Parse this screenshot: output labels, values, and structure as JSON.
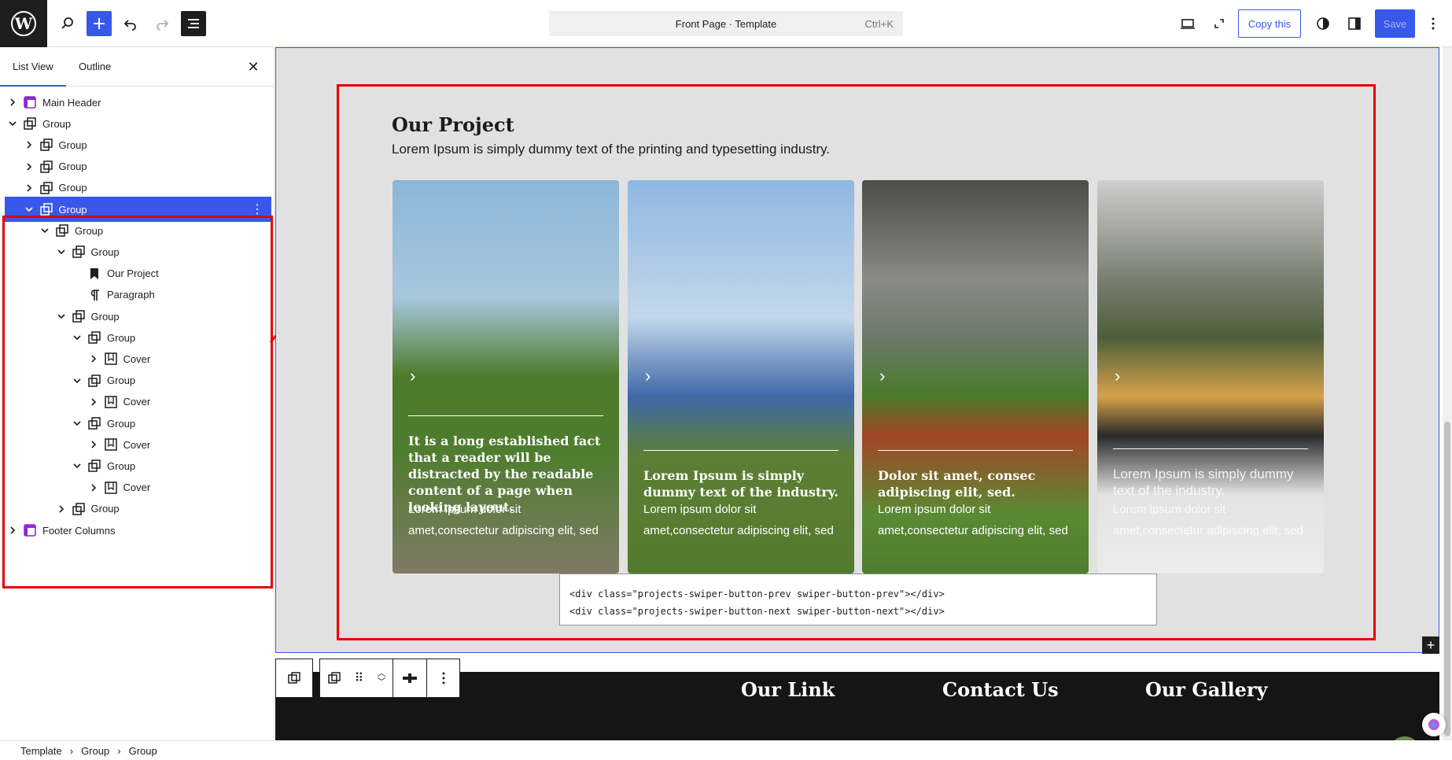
{
  "topbar": {
    "command_label": "Front Page · Template",
    "command_shortcut": "Ctrl+K",
    "copy_label": "Copy this",
    "save_label": "Save"
  },
  "sidebar": {
    "tabs": [
      "List View",
      "Outline"
    ],
    "items": [
      {
        "label": "Main Header"
      },
      {
        "label": "Group"
      },
      {
        "label": "Group"
      },
      {
        "label": "Group"
      },
      {
        "label": "Group"
      },
      {
        "label": "Group"
      },
      {
        "label": "Group"
      },
      {
        "label": "Group"
      },
      {
        "label": "Our Project"
      },
      {
        "label": "Paragraph"
      },
      {
        "label": "Group"
      },
      {
        "label": "Group"
      },
      {
        "label": "Cover"
      },
      {
        "label": "Group"
      },
      {
        "label": "Cover"
      },
      {
        "label": "Group"
      },
      {
        "label": "Cover"
      },
      {
        "label": "Group"
      },
      {
        "label": "Cover"
      },
      {
        "label": "Group"
      },
      {
        "label": "Footer Columns"
      }
    ]
  },
  "section": {
    "title": "Our Project",
    "subtitle": "Lorem Ipsum is simply dummy text of the printing and typesetting industry."
  },
  "cards": [
    {
      "title": "It is a long established fact that a reader will be distracted by the readable content of a page when looking layout.",
      "text": "Lorem ipsum dolor sit amet,consectetur adipiscing elit, sed"
    },
    {
      "title": "Lorem Ipsum is simply dummy text of the industry.",
      "text": "Lorem ipsum dolor sit amet,consectetur adipiscing elit, sed"
    },
    {
      "title": "Dolor sit amet, consec adipiscing elit, sed.",
      "text": "Lorem ipsum dolor sit amet,consectetur adipiscing elit, sed"
    },
    {
      "title": "Lorem Ipsum is simply dummy text of the industry.",
      "text": "Lorem ipsum dolor sit amet,consectetur adipiscing elit, sed"
    }
  ],
  "code": {
    "line1": "<div class=\"projects-swiper-button-prev swiper-button-prev\"></div>",
    "line2": "<div class=\"projects-swiper-button-next swiper-button-next\"></div>"
  },
  "footer": {
    "headings": [
      "Our Link",
      "Contact Us",
      "Our Gallery"
    ]
  },
  "breadcrumb": [
    "Template",
    "Group",
    "Group"
  ],
  "colors": {
    "accent": "#3858e9",
    "highlight": "#e30000",
    "canvas_bg": "#e1e1e1",
    "footer_bg": "#151515"
  }
}
